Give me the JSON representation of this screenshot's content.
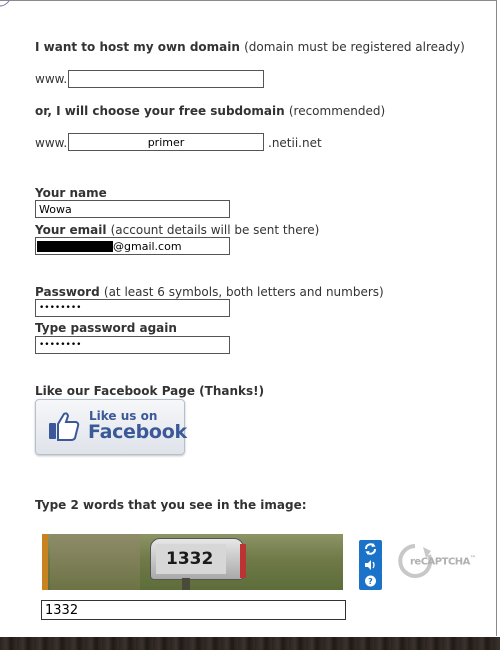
{
  "domain_section": {
    "own_domain_label": "I want to host my own domain",
    "own_domain_note": "(domain must be registered already)",
    "www_prefix": "www.",
    "own_domain_value": "",
    "subdomain_label": "or, I will choose your free subdomain",
    "subdomain_note": "(recommended)",
    "subdomain_value": "primer",
    "subdomain_suffix": ".netii.net"
  },
  "account_section": {
    "name_label": "Your name",
    "name_value": "Wowa",
    "email_label": "Your email",
    "email_note": "(account details will be sent there)",
    "email_value_visible": "@gmail.com",
    "password_label": "Password",
    "password_note": "(at least 6 symbols, both letters and numbers)",
    "password_value": "••••••••",
    "password_again_label": "Type password again",
    "password_again_value": "••••••••"
  },
  "facebook_section": {
    "label": "Like our Facebook Page (Thanks!)",
    "button_small": "Like us on",
    "button_big": "Facebook"
  },
  "captcha_section": {
    "label": "Type 2 words that you see in the image:",
    "image_text": "1332",
    "input_value": "1332",
    "logo_text": "reCAPTCHA",
    "logo_tm": "™"
  },
  "colors": {
    "facebook_blue": "#3b5998",
    "captcha_icon_blue": "#1a73c8"
  }
}
